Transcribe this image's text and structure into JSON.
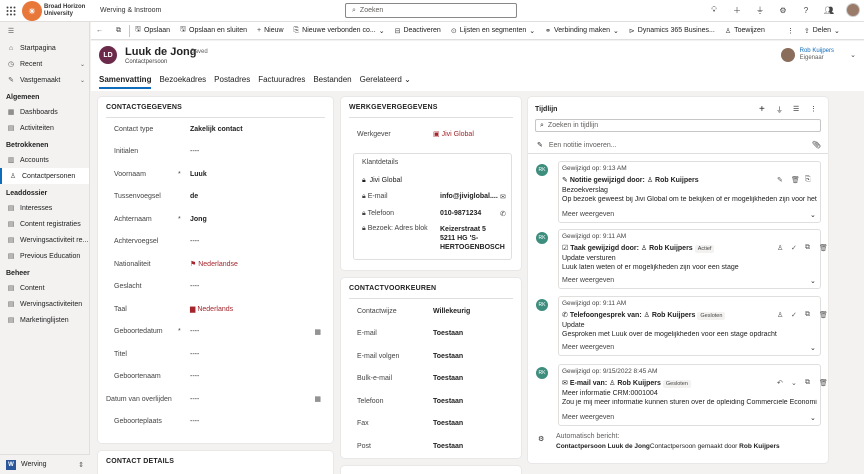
{
  "topbar": {
    "org_line1": "Broad Horizon",
    "org_line2": "University",
    "app_name": "Werving & Instroom",
    "search_placeholder": "Zoeken"
  },
  "sidebar": {
    "items": [
      {
        "label": "Startpagina",
        "icon": "home-icon"
      },
      {
        "label": "Recent",
        "icon": "clock-icon",
        "chevron": true
      },
      {
        "label": "Vastgemaakt",
        "icon": "pin-icon",
        "chevron": true
      }
    ],
    "groups": [
      {
        "title": "Algemeen",
        "items": [
          {
            "label": "Dashboards",
            "icon": "dashboard-icon"
          },
          {
            "label": "Activiteiten",
            "icon": "activity-icon"
          }
        ]
      },
      {
        "title": "Betrokkenen",
        "items": [
          {
            "label": "Accounts",
            "icon": "building-icon"
          },
          {
            "label": "Contactpersonen",
            "icon": "person-icon",
            "active": true
          }
        ]
      },
      {
        "title": "Leaddossier",
        "items": [
          {
            "label": "Interesses",
            "icon": "list-icon"
          },
          {
            "label": "Content registraties",
            "icon": "list-icon"
          },
          {
            "label": "Wervingsactiviteit re...",
            "icon": "list-icon"
          },
          {
            "label": "Previous Education",
            "icon": "list-icon"
          }
        ]
      },
      {
        "title": "Beheer",
        "items": [
          {
            "label": "Content",
            "icon": "list-icon"
          },
          {
            "label": "Wervingsactiviteiten",
            "icon": "list-icon"
          },
          {
            "label": "Marketinglijsten",
            "icon": "list-icon"
          }
        ]
      }
    ],
    "bottom_label": "Werving"
  },
  "commandbar": {
    "items": [
      "Opslaan",
      "Opslaan en sluiten",
      "Nieuw",
      "Nieuwe verbonden co...",
      "Deactiveren",
      "Lijsten en segmenten",
      "Verbinding maken",
      "Dynamics 365 Busines...",
      "Toewijzen",
      "Delen"
    ]
  },
  "record": {
    "initials": "LD",
    "name": "Luuk de Jong",
    "saved": "- Saved",
    "type": "Contactpersoon",
    "owner_name": "Rob Kuijpers",
    "owner_role": "Eigenaar",
    "tabs": [
      "Samenvatting",
      "Bezoekadres",
      "Postadres",
      "Factuuradres",
      "Bestanden",
      "Gerelateerd"
    ]
  },
  "contactgegevens": {
    "title": "CONTACTGEGEVENS",
    "fields": [
      {
        "label": "Contact type",
        "value": "Zakelijk contact",
        "req": false,
        "kind": "bold"
      },
      {
        "label": "Initialen",
        "value": "----",
        "req": false,
        "kind": "plain"
      },
      {
        "label": "Voornaam",
        "value": "Luuk",
        "req": true,
        "kind": "bold"
      },
      {
        "label": "Tussenvoegsel",
        "value": "de",
        "req": false,
        "kind": "bold"
      },
      {
        "label": "Achternaam",
        "value": "Jong",
        "req": true,
        "kind": "bold"
      },
      {
        "label": "Achtervoegsel",
        "value": "----",
        "req": false,
        "kind": "plain"
      },
      {
        "label": "Nationaliteit",
        "value": "Nederlandse",
        "req": false,
        "kind": "link"
      },
      {
        "label": "Geslacht",
        "value": "----",
        "req": false,
        "kind": "plain"
      },
      {
        "label": "Taal",
        "value": "Nederlands",
        "req": false,
        "kind": "link"
      },
      {
        "label": "Geboortedatum",
        "value": "----",
        "req": true,
        "kind": "plain",
        "calendar": true
      },
      {
        "label": "Titel",
        "value": "----",
        "req": false,
        "kind": "plain"
      },
      {
        "label": "Geboortenaam",
        "value": "----",
        "req": false,
        "kind": "plain"
      },
      {
        "label": "Datum van overlijden",
        "value": "----",
        "req": false,
        "kind": "plain",
        "calendar": true
      },
      {
        "label": "Geboorteplaats",
        "value": "----",
        "req": false,
        "kind": "plain"
      }
    ],
    "next_section": "CONTACT DETAILS"
  },
  "werkgever": {
    "title": "WERKGEVERGEGEVENS",
    "label": "Werkgever",
    "value": "Jivi Global",
    "klantdetails_title": "Klantdetails",
    "klant_name": "Jivi Global",
    "email_label": "E-mail",
    "email_value": "info@jiviglobal....",
    "phone_label": "Telefoon",
    "phone_value": "010-9871234",
    "address_label": "Bezoek: Adres blok",
    "address_line1": "Keizerstraat 5",
    "address_line2": "5211 HG 'S-",
    "address_line3": "HERTOGENBOSCH"
  },
  "contactvoorkeuren": {
    "title": "CONTACTVOORKEUREN",
    "fields": [
      {
        "label": "Contactwijze",
        "value": "Willekeurig"
      },
      {
        "label": "E-mail",
        "value": "Toestaan"
      },
      {
        "label": "E-mail volgen",
        "value": "Toestaan"
      },
      {
        "label": "Bulk-e-mail",
        "value": "Toestaan"
      },
      {
        "label": "Telefoon",
        "value": "Toestaan"
      },
      {
        "label": "Fax",
        "value": "Toestaan"
      },
      {
        "label": "Post",
        "value": "Toestaan"
      }
    ]
  },
  "tijdlijn": {
    "title": "Tijdlijn",
    "search_placeholder": "Zoeken in tijdlijn",
    "note_placeholder": "Een notitie invoeren...",
    "entries": [
      {
        "date": "Gewijzigd op: 9:13 AM",
        "kind": "Notitie gewijzigd door:",
        "who": "Rob Kuijpers",
        "badge": "",
        "line1": "Bezoekverslag",
        "line2": "Op bezoek geweest bij Jivi Global om te bekijken of er mogelijkheden zijn voor het on...",
        "more": "Meer weergeven"
      },
      {
        "date": "Gewijzigd op: 9:11 AM",
        "kind": "Taak gewijzigd door:",
        "who": "Rob Kuijpers",
        "badge": "Actief",
        "line1": "Update versturen",
        "line2": "Luuk laten weten of er mogelijkheden zijn voor een stage",
        "more": "Meer weergeven"
      },
      {
        "date": "Gewijzigd op: 9:11 AM",
        "kind": "Telefoongesprek van:",
        "who": "Rob Kuijpers",
        "badge": "Gesloten",
        "line1": "Update",
        "line2": "Gesproken met Luuk over de mogelijkheden voor een stage opdracht",
        "more": "Meer weergeven"
      },
      {
        "date": "Gewijzigd op: 9/15/2022 8:45 AM",
        "kind": "E-mail van:",
        "who": "Rob Kuijpers",
        "badge": "Gesloten",
        "line1": "Meer informatie CRM:0001004",
        "line2": "Zou je mij meer informatie kunnen sturen over de opleiding Commerciele Economie? I...",
        "more": "Meer weergeven"
      }
    ],
    "auto_label": "Automatisch bericht:",
    "auto_contact_label": "Contactpersoon",
    "auto_contact": "Luuk de Jong",
    "auto_tail": "Contactpersoon gemaakt door",
    "auto_who": "Rob Kuijpers",
    "avatar_initials": "RK"
  },
  "colors": {
    "accent": "#0f6cbd",
    "link_red": "#a4262c",
    "logo_orange": "#e8773a",
    "avatar_teal": "#3e8e7e"
  }
}
